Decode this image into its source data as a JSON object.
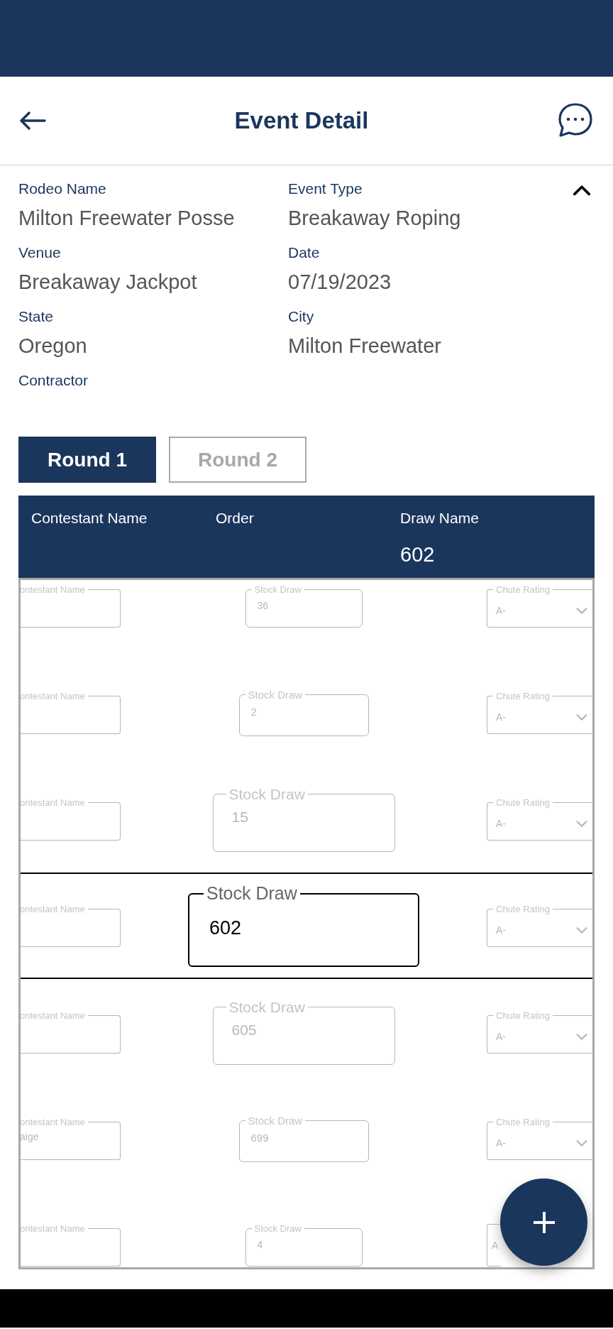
{
  "header": {
    "title": "Event Detail"
  },
  "details": {
    "expanded": true,
    "fields": [
      {
        "label": "Rodeo Name",
        "value": "Milton Freewater Posse"
      },
      {
        "label": "Event Type",
        "value": "Breakaway Roping"
      },
      {
        "label": "Venue",
        "value": "Breakaway Jackpot"
      },
      {
        "label": "Date",
        "value": "07/19/2023"
      },
      {
        "label": "State",
        "value": "Oregon"
      },
      {
        "label": "City",
        "value": "Milton Freewater"
      },
      {
        "label": "Contractor"
      }
    ]
  },
  "rounds": [
    {
      "label": "Round 1",
      "selected": true
    },
    {
      "label": "Round 2",
      "selected": false
    }
  ],
  "table": {
    "columns": [
      "Contestant Name",
      "Order",
      "Draw Name"
    ],
    "draw_value": "602",
    "rows": [
      {
        "kind": "small",
        "selected": false,
        "contestant_label": "ontestant Name",
        "stock_label": "Stock Draw",
        "stock_value": "36",
        "chute_label": "Chute Rating",
        "chute_value": "A-"
      },
      {
        "kind": "medium",
        "selected": false,
        "contestant_label": "ontestant Name",
        "stock_label": "Stock Draw",
        "stock_value": "2",
        "chute_label": "Chute Rating",
        "chute_value": "A-"
      },
      {
        "kind": "large",
        "selected": false,
        "contestant_label": "ontestant Name",
        "stock_label": "Stock Draw",
        "stock_value": "15",
        "chute_label": "Chute Rating",
        "chute_value": "A-"
      },
      {
        "kind": "active",
        "selected": true,
        "contestant_label": "ontestant Name",
        "stock_label": "Stock Draw",
        "stock_value": "602",
        "chute_label": "Chute Rating",
        "chute_value": "A-"
      },
      {
        "kind": "large",
        "selected": false,
        "contestant_label": "ontestant Name",
        "stock_label": "Stock Draw",
        "stock_value": "605",
        "chute_label": "Chute Rating",
        "chute_value": "A-"
      },
      {
        "kind": "medium",
        "selected": false,
        "contestant_label": "ontestant Name",
        "contestant_value": "aige",
        "stock_label": "Stock Draw",
        "stock_value": "699",
        "chute_label": "Chute Rating",
        "chute_value": "A-"
      },
      {
        "kind": "small",
        "selected": false,
        "contestant_label": "ontestant Name",
        "stock_label": "Stock Draw",
        "stock_value": "4",
        "chute_value": "A"
      }
    ]
  }
}
